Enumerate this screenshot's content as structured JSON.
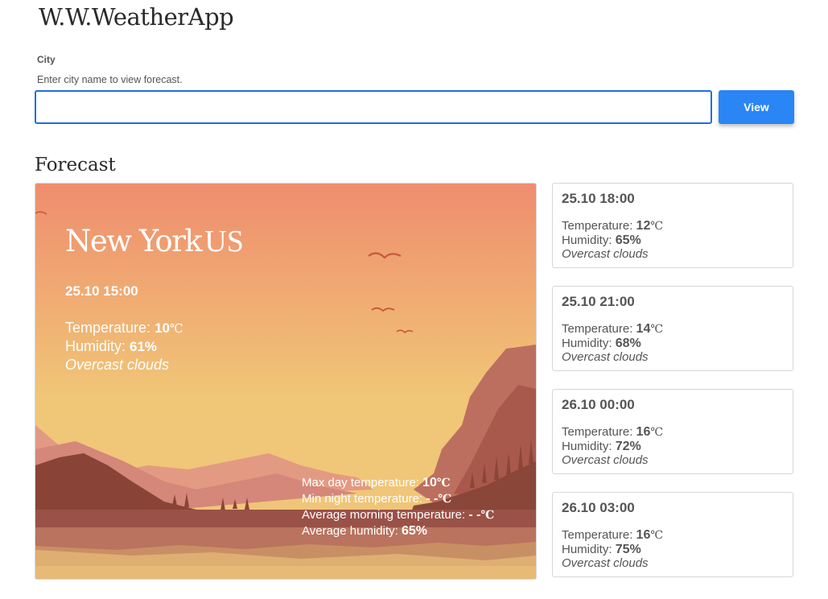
{
  "app": {
    "title": "W.W.WeatherApp"
  },
  "search": {
    "label": "City",
    "hint": "Enter city name to view forecast.",
    "value": "",
    "placeholder": "",
    "button_label": "View"
  },
  "forecast": {
    "heading": "Forecast",
    "units": {
      "temp": "℃"
    },
    "labels": {
      "temperature": "Temperature: ",
      "humidity": "Humidity: ",
      "max_day": "Max day temperature: ",
      "min_night": "Min night temperature: ",
      "avg_morning": "Average morning temperature: ",
      "avg_humidity": "Average humidity: "
    },
    "current": {
      "city": "New York",
      "country": "US",
      "time": "25.10 15:00",
      "temperature": "10",
      "humidity": "61%",
      "description": "Overcast clouds"
    },
    "summary": {
      "max_day": "10",
      "min_night": "- -",
      "avg_morning": "- -",
      "avg_humidity": "65%"
    },
    "items": [
      {
        "time": "25.10 18:00",
        "temperature": "12",
        "humidity": "65%",
        "description": "Overcast clouds"
      },
      {
        "time": "25.10 21:00",
        "temperature": "14",
        "humidity": "68%",
        "description": "Overcast clouds"
      },
      {
        "time": "26.10 00:00",
        "temperature": "16",
        "humidity": "72%",
        "description": "Overcast clouds"
      },
      {
        "time": "26.10 03:00",
        "temperature": "16",
        "humidity": "75%",
        "description": "Overcast clouds"
      }
    ]
  },
  "colors": {
    "accent": "#2a85f5",
    "input_border": "#1e6fe0",
    "sky_top": "#ef8d6e",
    "sky_bottom": "#f0c777"
  }
}
